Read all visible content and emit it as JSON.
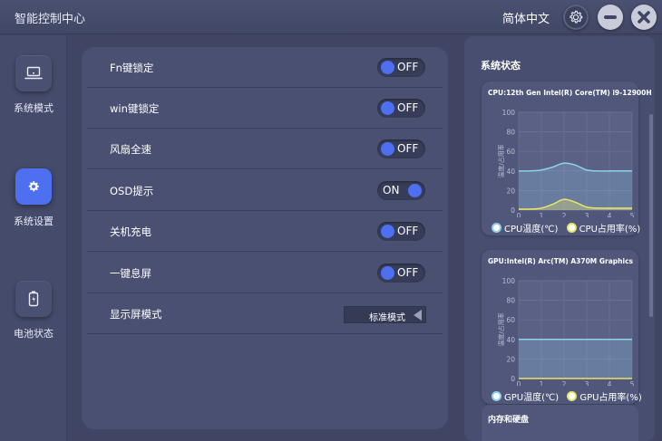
{
  "window": {
    "title": "智能控制中心",
    "language": "简体中文"
  },
  "sidebar": {
    "items": [
      {
        "label": "系统模式",
        "icon": "laptop-icon",
        "active": false
      },
      {
        "label": "系统设置",
        "icon": "gear-icon",
        "active": true
      },
      {
        "label": "电池状态",
        "icon": "battery-icon",
        "active": false
      }
    ]
  },
  "settings": {
    "rows": [
      {
        "label": "Fn键锁定",
        "type": "toggle",
        "state": "OFF"
      },
      {
        "label": "win键锁定",
        "type": "toggle",
        "state": "OFF"
      },
      {
        "label": "风扇全速",
        "type": "toggle",
        "state": "OFF"
      },
      {
        "label": "OSD提示",
        "type": "toggle",
        "state": "ON"
      },
      {
        "label": "关机充电",
        "type": "toggle",
        "state": "OFF"
      },
      {
        "label": "一键息屏",
        "type": "toggle",
        "state": "OFF"
      },
      {
        "label": "显示屏模式",
        "type": "select",
        "value": "标准模式"
      }
    ]
  },
  "status": {
    "title": "系统状态",
    "memory_title": "内存和硬盘"
  },
  "colors": {
    "accent": "#4d6ff0",
    "temp_series": "#8fd0ec",
    "usage_series": "#e9e46a"
  },
  "chart_data": [
    {
      "type": "area",
      "title": "CPU:12th Gen Intel(R) Core(TM) i9-12900H",
      "ylabel": "温度/占用率",
      "x": [
        0,
        0.5,
        1,
        1.5,
        2,
        2.5,
        3,
        3.5,
        4,
        4.5,
        5
      ],
      "ylim": [
        0,
        100
      ],
      "xlim": [
        0,
        5
      ],
      "yticks": [
        "0",
        "20",
        "40",
        "60",
        "80",
        "100"
      ],
      "xticks": [
        "0",
        "1",
        "2",
        "3",
        "4",
        "5"
      ],
      "series": [
        {
          "name": "CPU温度(℃)",
          "values": [
            40,
            40,
            41,
            44,
            48,
            46,
            41,
            40,
            40,
            40,
            40
          ]
        },
        {
          "name": "CPU占用率(%)",
          "values": [
            1,
            1,
            2,
            6,
            11,
            8,
            3,
            2,
            2,
            2,
            2
          ]
        }
      ],
      "grid": true
    },
    {
      "type": "area",
      "title": "GPU:Intel(R) Arc(TM) A370M Graphics",
      "ylabel": "温度/占用率",
      "x": [
        0,
        0.5,
        1,
        1.5,
        2,
        2.5,
        3,
        3.5,
        4,
        4.5,
        5
      ],
      "ylim": [
        0,
        100
      ],
      "xlim": [
        0,
        5
      ],
      "yticks": [
        "0",
        "20",
        "40",
        "60",
        "80",
        "100"
      ],
      "xticks": [
        "0",
        "1",
        "2",
        "3",
        "4",
        "5"
      ],
      "series": [
        {
          "name": "GPU温度(℃)",
          "values": [
            40,
            40,
            40,
            40,
            40,
            40,
            40,
            40,
            40,
            40,
            40
          ]
        },
        {
          "name": "GPU占用率(%)",
          "values": [
            0,
            0,
            0,
            0,
            0,
            0,
            0,
            0,
            0,
            0,
            0
          ]
        }
      ],
      "grid": true
    }
  ]
}
